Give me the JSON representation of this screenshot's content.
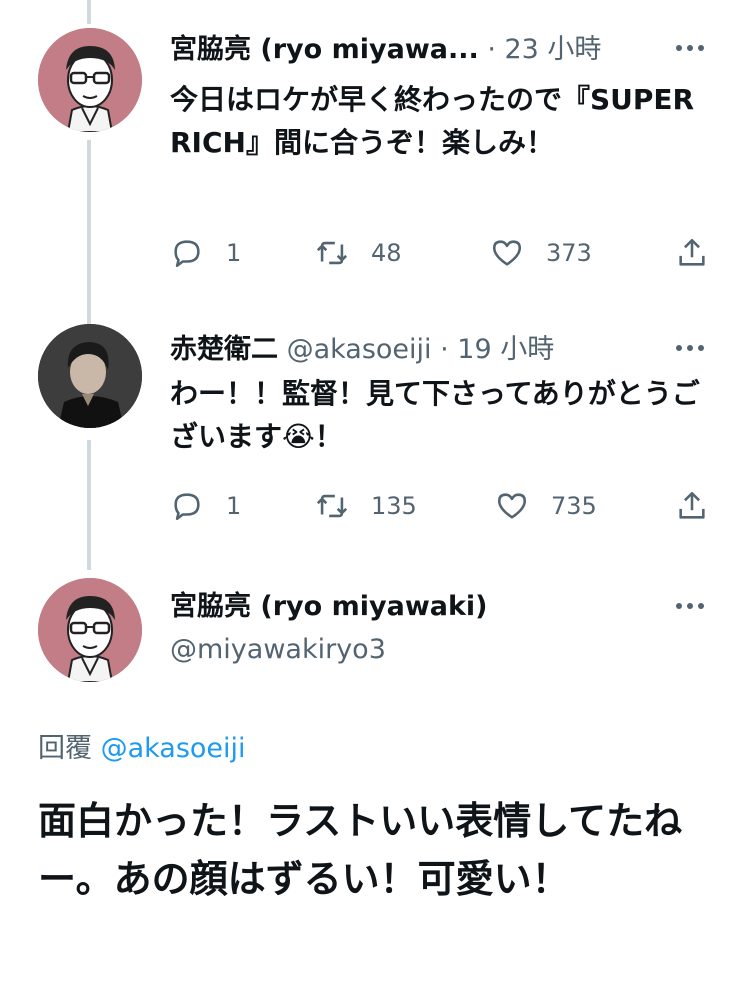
{
  "tweets": [
    {
      "name": "宮脇亮 (ryo miyawa...",
      "meta": " · 23 小時",
      "text": "今日はロケが早く終わったので『SUPER RICH』間に合うぞ！楽しみ！",
      "replies": "1",
      "retweets": "48",
      "likes": "373"
    },
    {
      "name": "赤楚衛二",
      "meta": " @akasoeiji · 19 小時",
      "text": "わー！！監督！見て下さってありがとうございます😭！",
      "replies": "1",
      "retweets": "135",
      "likes": "735"
    }
  ],
  "main_tweet": {
    "name": "宮脇亮 (ryo miyawaki)",
    "handle": "@miyawakiryo3",
    "reply_prefix": "回覆",
    "reply_mention": "@akasoeiji",
    "text": "面白かった！ラストいい表情してたねー。あの顔はずるい！可愛い！"
  },
  "icons": {
    "more": "more-dots-icon",
    "reply": "reply-icon",
    "retweet": "retweet-icon",
    "like": "heart-icon",
    "share": "share-icon"
  },
  "colors": {
    "text": "#0f1419",
    "secondary": "#536471",
    "link": "#1d9bf0",
    "thread_line": "#cfd9de",
    "avatar_bg_pink": "#c27d86"
  }
}
